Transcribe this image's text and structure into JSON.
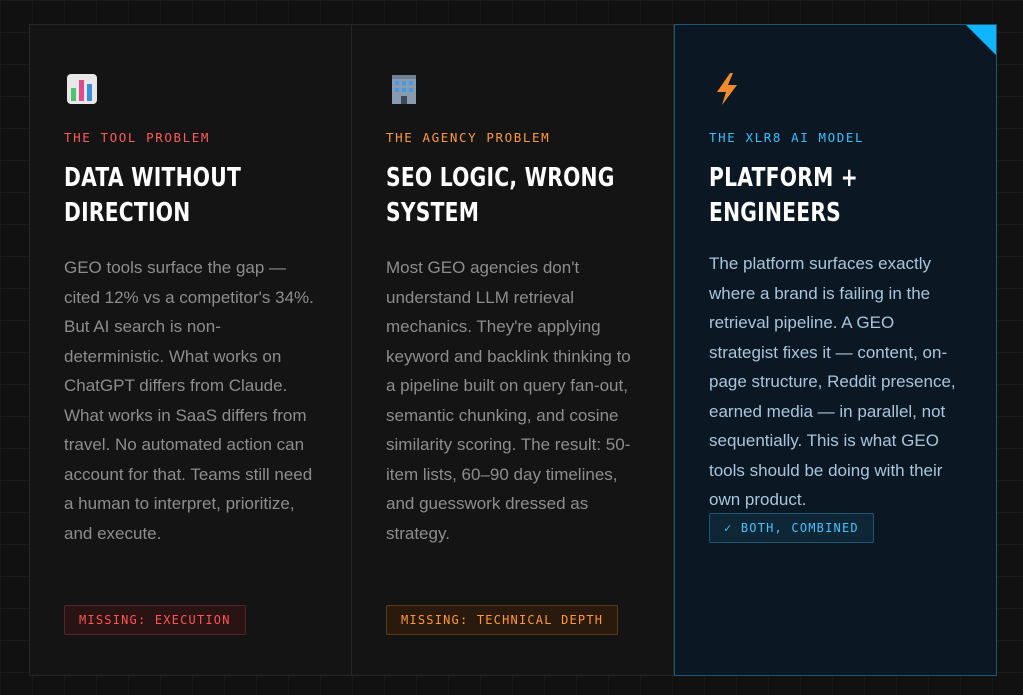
{
  "cards": [
    {
      "icon": "bar-chart-icon",
      "eyebrow": "THE TOOL PROBLEM",
      "title": "DATA WITHOUT DIRECTION",
      "body": "GEO tools surface the gap — cited 12% vs a competitor's 34%. But AI search is non-deterministic. What works on ChatGPT differs from Claude. What works in SaaS differs from travel. No automated action can account for that. Teams still need a human to interpret, prioritize, and execute.",
      "badge": "MISSING: EXECUTION",
      "accent": "#ff5a5a"
    },
    {
      "icon": "office-building-icon",
      "eyebrow": "THE AGENCY PROBLEM",
      "title": "SEO LOGIC, WRONG SYSTEM",
      "body": "Most GEO agencies don't understand LLM retrieval mechanics. They're applying keyword and backlink thinking to a pipeline built on query fan-out, semantic chunking, and cosine similarity scoring. The result: 50-item lists, 60–90 day timelines, and guesswork dressed as strategy.",
      "badge": "MISSING: TECHNICAL DEPTH",
      "accent": "#ff9a3c"
    },
    {
      "icon": "lightning-bolt-icon",
      "eyebrow": "THE XLR8 AI MODEL",
      "title": "PLATFORM + ENGINEERS",
      "body": "The platform surfaces exactly where a brand is failing in the retrieval pipeline. A GEO strategist fixes it — content, on-page structure, Reddit presence, earned media — in parallel, not sequentially. This is what GEO tools should be doing with their own product.",
      "badge": "✓ BOTH, COMBINED",
      "accent": "#34c0ff"
    }
  ]
}
